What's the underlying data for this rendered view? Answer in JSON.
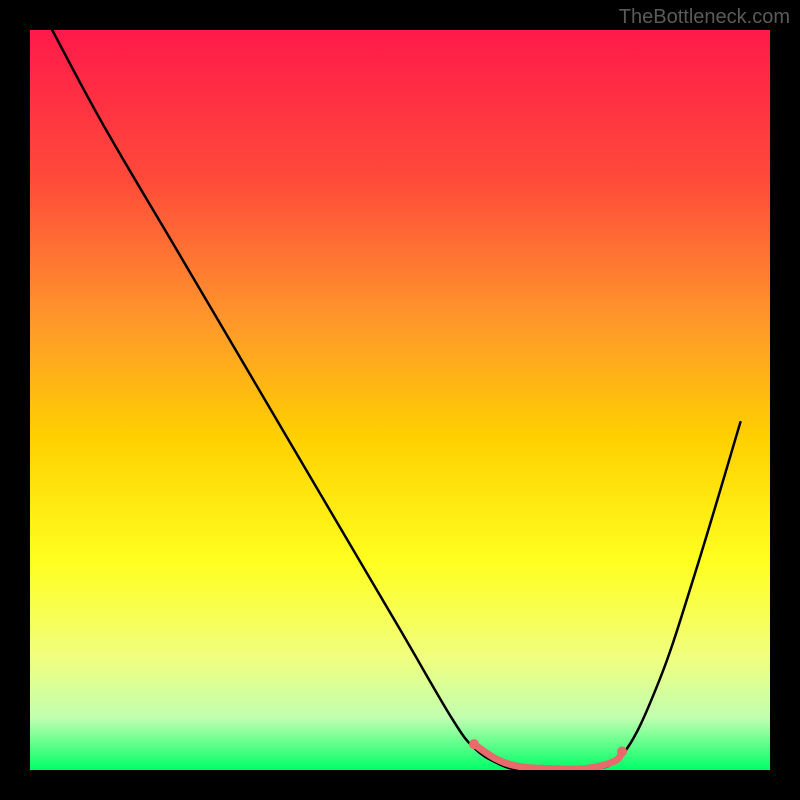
{
  "watermark": "TheBottleneck.com",
  "chart_data": {
    "type": "line",
    "title": "",
    "xlabel": "",
    "ylabel": "",
    "xlim": [
      0,
      100
    ],
    "ylim": [
      0,
      100
    ],
    "background_gradient": {
      "stops": [
        {
          "offset": 0,
          "color": "#ff1a4a"
        },
        {
          "offset": 20,
          "color": "#ff4a3a"
        },
        {
          "offset": 40,
          "color": "#ff9a2a"
        },
        {
          "offset": 55,
          "color": "#ffd000"
        },
        {
          "offset": 72,
          "color": "#ffff20"
        },
        {
          "offset": 85,
          "color": "#f0ff80"
        },
        {
          "offset": 93,
          "color": "#c0ffb0"
        },
        {
          "offset": 100,
          "color": "#00ff66"
        }
      ]
    },
    "series": [
      {
        "name": "bottleneck-curve",
        "type": "line",
        "color": "#000000",
        "x": [
          3,
          10,
          20,
          30,
          40,
          50,
          57,
          60,
          63,
          66,
          70,
          75,
          80,
          85,
          90,
          96
        ],
        "y": [
          100,
          87,
          70,
          53,
          36,
          19,
          7,
          3,
          1,
          0,
          0,
          0,
          2,
          12,
          27,
          47
        ]
      },
      {
        "name": "optimal-range",
        "type": "line",
        "color": "#e86a6a",
        "stroke_width": 7,
        "x": [
          60,
          63,
          66,
          70,
          75,
          79,
          80
        ],
        "y": [
          3.5,
          1.5,
          0.5,
          0.2,
          0.2,
          1.2,
          2.5
        ]
      }
    ],
    "markers": [
      {
        "name": "range-start-dot",
        "x": 60,
        "y": 3.5,
        "color": "#e86a6a",
        "r": 5
      },
      {
        "name": "range-end-dot",
        "x": 80,
        "y": 2.5,
        "color": "#e86a6a",
        "r": 5
      }
    ]
  }
}
